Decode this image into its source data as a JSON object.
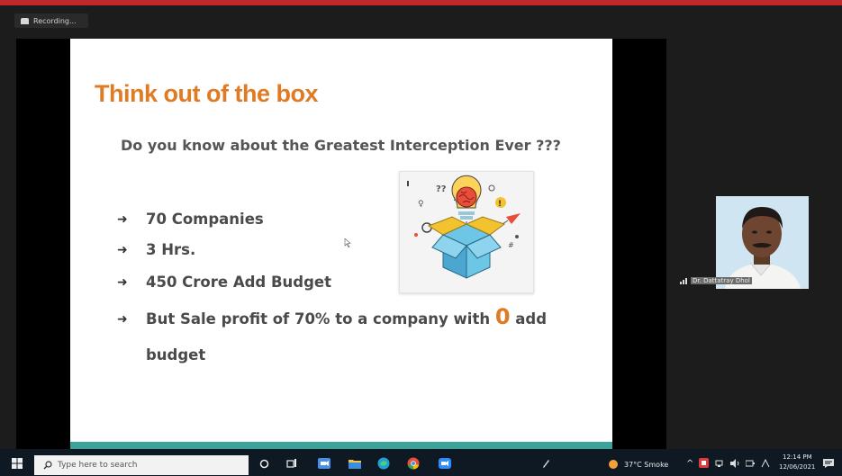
{
  "recording": {
    "label": "Recording..."
  },
  "slide": {
    "title": "Think out of the box",
    "subtitle": "Do you know about the Greatest Interception Ever ???",
    "bullets": [
      "70 Companies",
      "3 Hrs.",
      "450 Crore Add Budget"
    ],
    "bullet4": {
      "before": "But Sale profit of 70% to a company with ",
      "highlight": "0",
      "after": " add budget"
    },
    "illustration": "lightbulb-brain-box-icon",
    "colors": {
      "title": "#e07a23",
      "footer_band": "#3aa39a"
    }
  },
  "participant": {
    "name": "Dr. Dattatray Dhol"
  },
  "taskbar": {
    "search_placeholder": "Type here to search",
    "weather": "37°C Smoke",
    "time": "12:14 PM",
    "date": "12/06/2021"
  }
}
